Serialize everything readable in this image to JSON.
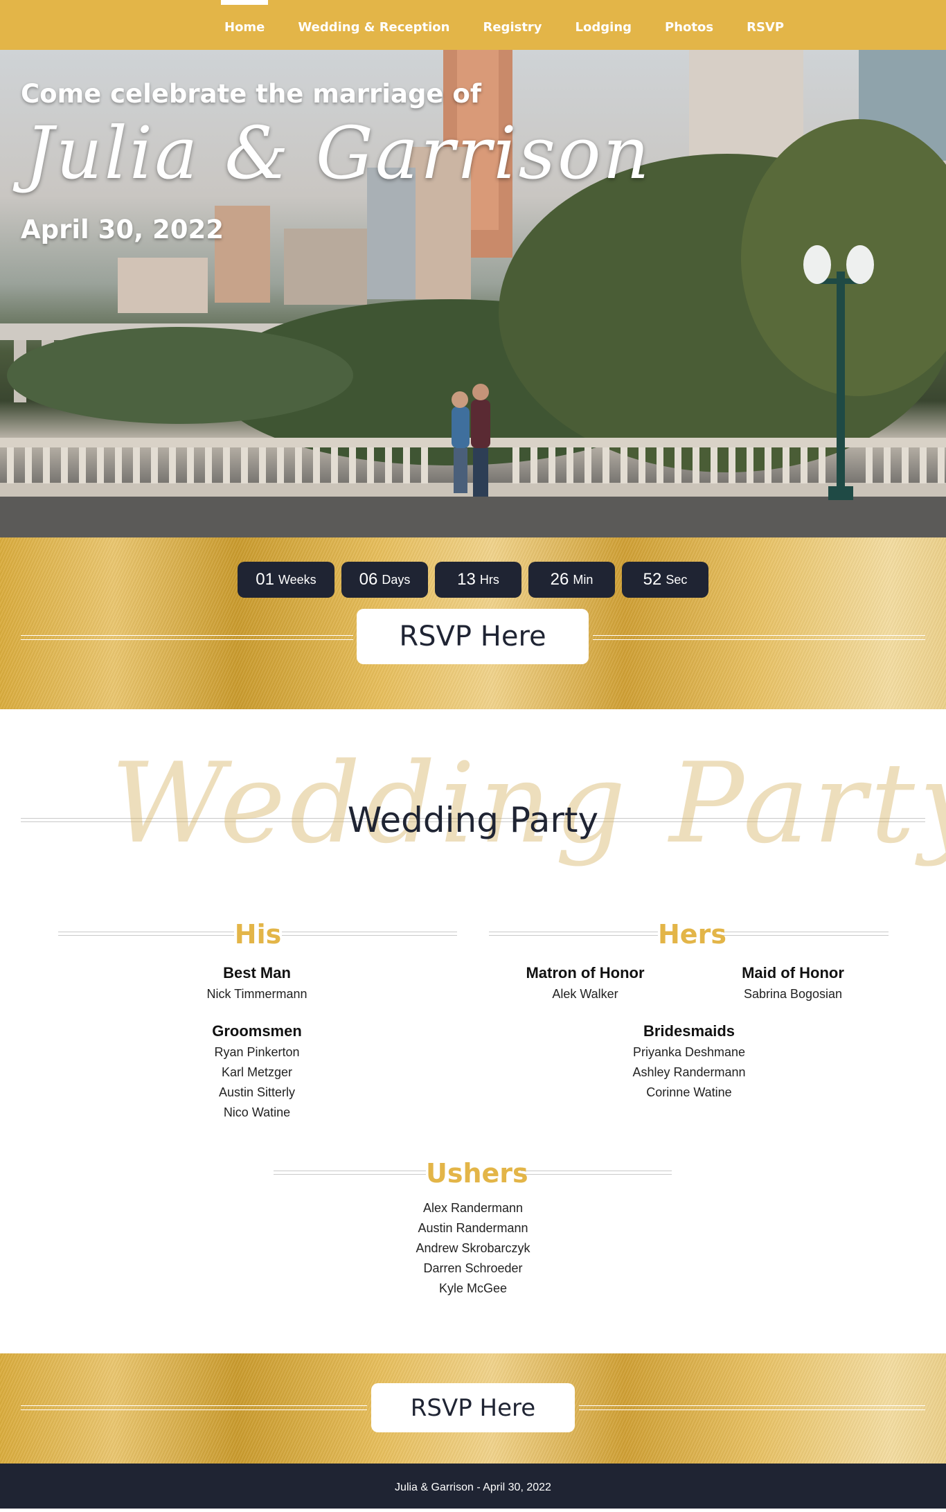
{
  "nav": {
    "items": [
      "Home",
      "Wedding & Reception",
      "Registry",
      "Lodging",
      "Photos",
      "RSVP"
    ],
    "active": "Home"
  },
  "hero": {
    "intro": "Come celebrate the marriage of",
    "names": "Julia & Garrison",
    "date": "April 30, 2022"
  },
  "countdown": [
    {
      "value": "01",
      "unit": "Weeks"
    },
    {
      "value": "06",
      "unit": "Days"
    },
    {
      "value": "13",
      "unit": "Hrs"
    },
    {
      "value": "26",
      "unit": "Min"
    },
    {
      "value": "52",
      "unit": "Sec"
    }
  ],
  "rsvp_label": "RSVP Here",
  "party": {
    "script": "Wedding Party",
    "title": "Wedding Party",
    "his": {
      "heading": "His",
      "best_man_role": "Best Man",
      "best_man": "Nick Timmermann",
      "groomsmen_role": "Groomsmen",
      "groomsmen": [
        "Ryan Pinkerton",
        "Karl Metzger",
        "Austin Sitterly",
        "Nico Watine"
      ]
    },
    "hers": {
      "heading": "Hers",
      "matron_role": "Matron of Honor",
      "matron": "Alek Walker",
      "maid_role": "Maid of Honor",
      "maid": "Sabrina Bogosian",
      "bridesmaids_role": "Bridesmaids",
      "bridesmaids": [
        "Priyanka Deshmane",
        "Ashley Randermann",
        "Corinne Watine"
      ]
    },
    "ushers": {
      "heading": "Ushers",
      "names": [
        "Alex Randermann",
        "Austin Randermann",
        "Andrew Skrobarczyk",
        "Darren Schroeder",
        "Kyle McGee"
      ]
    }
  },
  "footer": {
    "text": "Julia & Garrison - April 30, 2022"
  },
  "colors": {
    "gold": "#e3b548",
    "navy": "#1f2433",
    "white": "#ffffff"
  }
}
